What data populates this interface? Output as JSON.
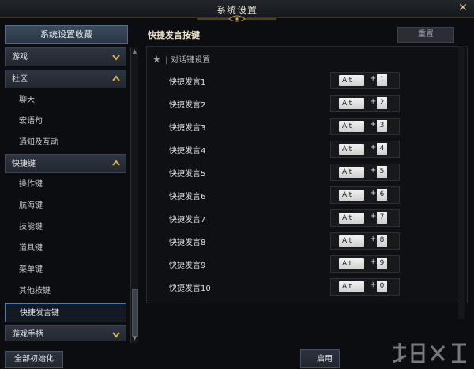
{
  "window": {
    "title": "系统设置"
  },
  "sidebar": {
    "favorites_label": "系统设置收藏",
    "items": [
      {
        "type": "category",
        "label": "游戏",
        "expanded": false
      },
      {
        "type": "category",
        "label": "社区",
        "expanded": true
      },
      {
        "type": "sub",
        "label": "聊天"
      },
      {
        "type": "sub",
        "label": "宏语句"
      },
      {
        "type": "sub",
        "label": "通知及互动"
      },
      {
        "type": "category",
        "label": "快捷键",
        "expanded": true
      },
      {
        "type": "sub",
        "label": "操作键"
      },
      {
        "type": "sub",
        "label": "航海键"
      },
      {
        "type": "sub",
        "label": "技能键"
      },
      {
        "type": "sub",
        "label": "道具键"
      },
      {
        "type": "sub",
        "label": "菜单键"
      },
      {
        "type": "sub",
        "label": "其他按键"
      },
      {
        "type": "sub",
        "label": "快捷发言键",
        "selected": true
      },
      {
        "type": "category",
        "label": "游戏手柄",
        "expanded": false
      }
    ],
    "reset_all_label": "全部初始化"
  },
  "content": {
    "title": "快捷发言按键",
    "reset_label": "重置",
    "section_title": "对话键设置",
    "rows": [
      {
        "label": "快捷发言1",
        "modifier": "Alt",
        "plus": "+",
        "key": "1"
      },
      {
        "label": "快捷发言2",
        "modifier": "Alt",
        "plus": "+",
        "key": "2"
      },
      {
        "label": "快捷发言3",
        "modifier": "Alt",
        "plus": "+",
        "key": "3"
      },
      {
        "label": "快捷发言4",
        "modifier": "Alt",
        "plus": "+",
        "key": "4"
      },
      {
        "label": "快捷发言5",
        "modifier": "Alt",
        "plus": "+",
        "key": "5"
      },
      {
        "label": "快捷发言6",
        "modifier": "Alt",
        "plus": "+",
        "key": "6"
      },
      {
        "label": "快捷发言7",
        "modifier": "Alt",
        "plus": "+",
        "key": "7"
      },
      {
        "label": "快捷发言8",
        "modifier": "Alt",
        "plus": "+",
        "key": "8"
      },
      {
        "label": "快捷发言9",
        "modifier": "Alt",
        "plus": "+",
        "key": "9"
      },
      {
        "label": "快捷发言10",
        "modifier": "Alt",
        "plus": "+",
        "key": "0"
      }
    ]
  },
  "footer": {
    "apply_label": "启用"
  },
  "colors": {
    "accent_gold": "#d8b04a",
    "selected_border": "#4f7bb0"
  }
}
